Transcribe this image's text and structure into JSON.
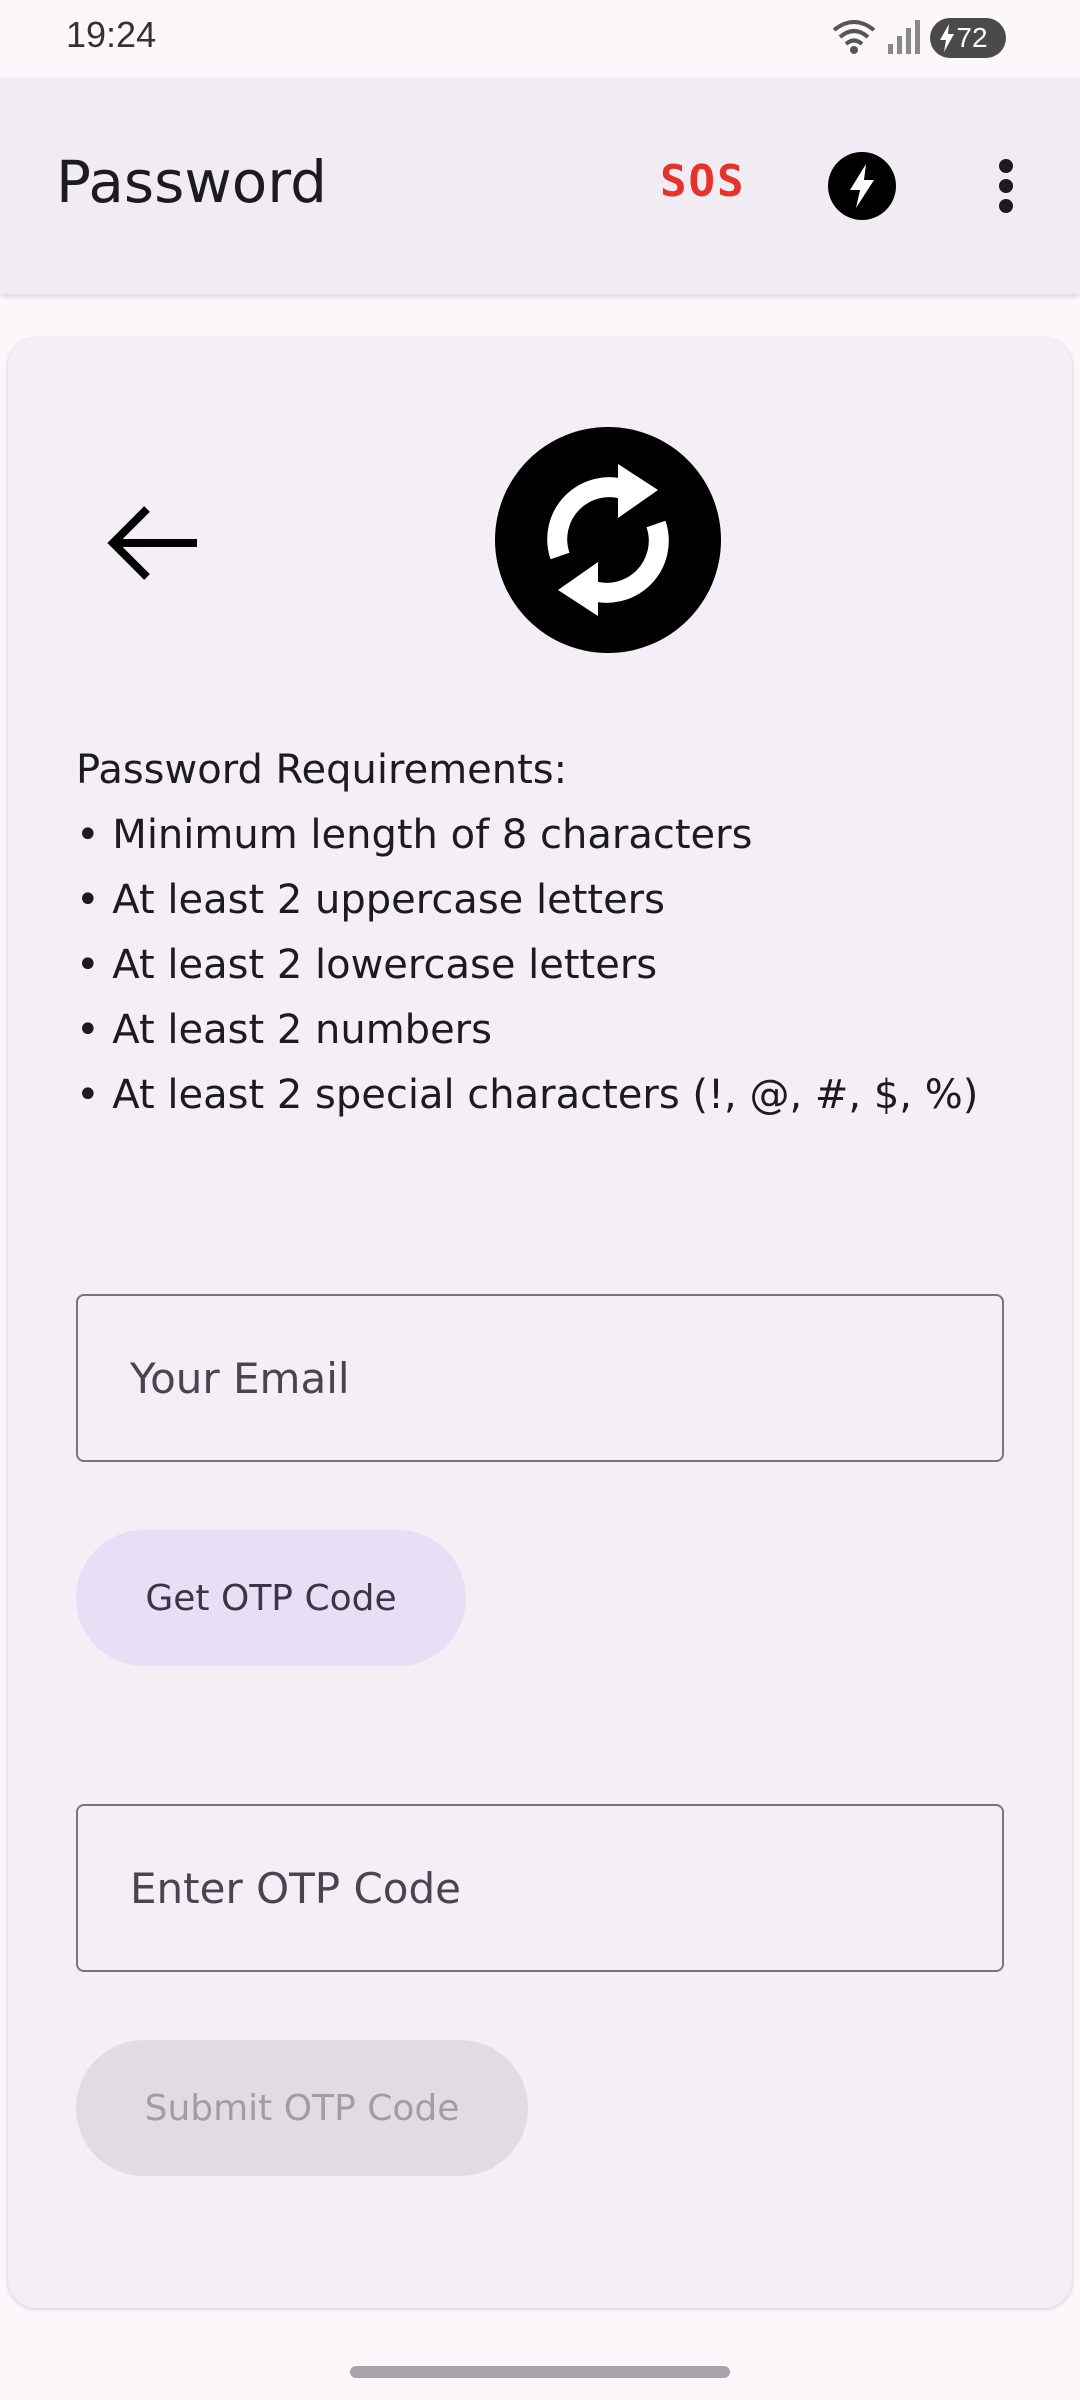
{
  "status_bar": {
    "time": "19:24",
    "battery": "72",
    "icons": [
      "wifi-icon",
      "signal-icon",
      "battery-icon"
    ]
  },
  "app_bar": {
    "title": "Password",
    "sos_label": "SOS",
    "icons": [
      "flash-icon",
      "more-vert-icon"
    ]
  },
  "card": {
    "requirements": [
      "Password Requirements:",
      "• Minimum length of 8 characters",
      "• At least 2 uppercase letters",
      "• At least 2 lowercase letters",
      "• At least 2 numbers",
      "• At least 2 special characters (!, @, #, $, %)"
    ],
    "email_placeholder": "Your Email",
    "get_otp_label": "Get OTP Code",
    "otp_placeholder": "Enter OTP Code",
    "submit_otp_label": "Submit OTP Code"
  },
  "colors": {
    "sos": "#e5332a",
    "get_otp_bg": "#e7dff6",
    "submit_disabled_bg": "#e0dce1"
  }
}
